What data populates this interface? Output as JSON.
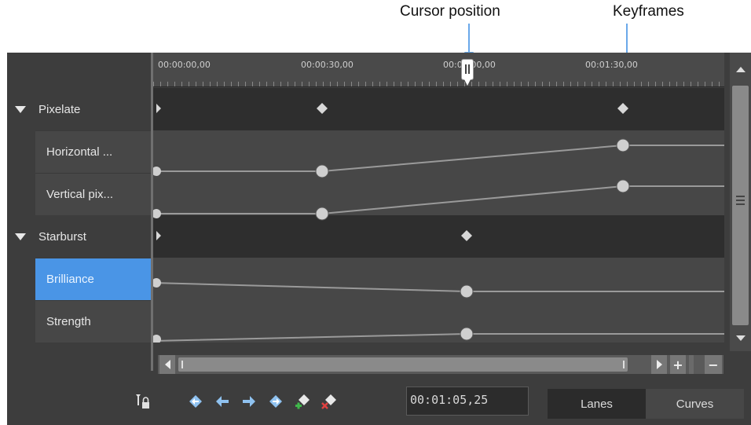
{
  "callouts": {
    "cursor_position": "Cursor position",
    "keyframes": "Keyframes"
  },
  "ruler": {
    "tick_labels": [
      "00:00:00,00",
      "00:00:30,00",
      "00:01:00,00",
      "00:01:30,00"
    ]
  },
  "tracks": {
    "pixelate": {
      "label": "Pixelate",
      "expanded": true
    },
    "horizontal": {
      "label": "Horizontal ..."
    },
    "vertical": {
      "label": "Vertical pix..."
    },
    "starburst": {
      "label": "Starburst",
      "expanded": true
    },
    "brilliance": {
      "label": "Brilliance",
      "selected": true
    },
    "strength": {
      "label": "Strength"
    }
  },
  "toolbar": {
    "timecode_value": "00:01:05,25",
    "icons": [
      "lock-keyframes-icon",
      "seek-previous-keyframe-icon",
      "seek-backward-icon",
      "seek-forward-icon",
      "seek-next-keyframe-icon",
      "add-keyframe-icon",
      "remove-keyframe-icon"
    ]
  },
  "view_tabs": {
    "lanes": "Lanes",
    "curves": "Curves",
    "active": "lanes"
  },
  "colors": {
    "background": "#3d3d3d",
    "selection": "#4a95e6",
    "callout_arrow": "#6aa8ea",
    "keyframe": "#d8d8d8"
  }
}
